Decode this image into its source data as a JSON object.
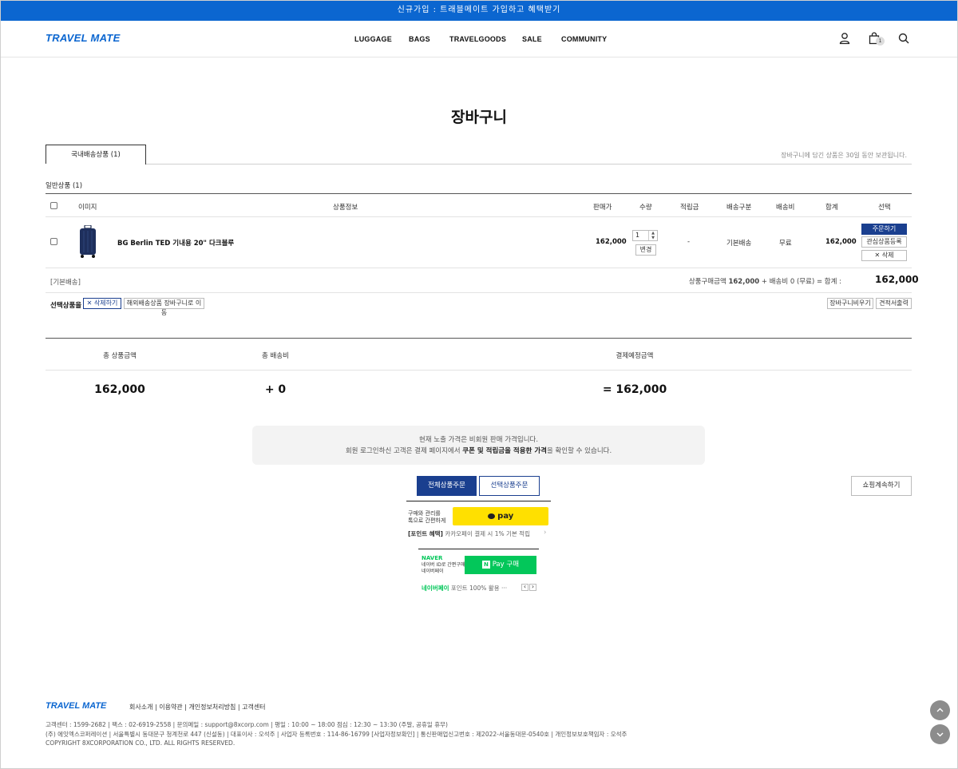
{
  "topbar": {
    "text": "신규가입 : 트래블메이트 가입하고 혜택받기"
  },
  "header": {
    "logo": "TRAVEL MATE",
    "nav": [
      "LUGGAGE",
      "BAGS",
      "TRAVELGOODS",
      "SALE",
      "COMMUNITY"
    ],
    "cart_count": "1",
    "icons": [
      "user-icon",
      "cart-icon",
      "search-icon"
    ]
  },
  "page": {
    "title": "장바구니",
    "tab_label": "국내배송상품 (1)",
    "keep_note": "장바구니에 담긴 상품은 30일 동안 보관됩니다.",
    "section_title": "일반상품 (1)"
  },
  "table": {
    "headers": {
      "image": "이미지",
      "info": "상품정보",
      "price": "판매가",
      "qty": "수량",
      "points": "적립금",
      "ship_type": "배송구분",
      "ship_fee": "배송비",
      "total": "합계",
      "select": "선택"
    },
    "row": {
      "name": "BG Berlin TED 기내용 20\" 다크블루",
      "price": "162,000",
      "qty": "1",
      "change_label": "변경",
      "points": "-",
      "ship_type": "기본배송",
      "ship_fee": "무료",
      "total": "162,000",
      "order_label": "주문하기",
      "wish_label": "관심상품등록",
      "delete_label": "✕ 삭제"
    },
    "group_label": "[기본배송]",
    "summary_prefix": "상품구매금액 ",
    "summary_amount": "162,000",
    "summary_suffix": " + 배송비 0 (무료) = 합계 :",
    "summary_total": "162,000"
  },
  "selected_actions": {
    "label": "선택상품을",
    "delete_label": "✕ 삭제하기",
    "move_label": "해외배송상품 장바구니로 이동",
    "empty_label": "장바구니비우기",
    "estimate_label": "견적서출력"
  },
  "totals": {
    "product_label": "총 상품금액",
    "product_value": "162,000",
    "shipping_label": "총 배송비",
    "shipping_value": "+ 0",
    "pay_label": "결제예정금액",
    "pay_value": "= 162,000"
  },
  "notice": {
    "line1": "현재 노출 가격은 비회원 판매 가격입니다.",
    "line2_prefix": "회원 로그인하신 고객은 결제 페이지에서 ",
    "line2_bold": "쿠폰 및 적립금을 적용한 가격",
    "line2_suffix": "을 확인할 수 있습니다."
  },
  "order_buttons": {
    "all_label": "전체상품주문",
    "selected_label": "선택상품주문",
    "continue_label": "쇼핑계속하기"
  },
  "kakao": {
    "desc_line1": "구매와 관리를",
    "desc_line2": "톡으로 간편하게",
    "pay_label": "pay",
    "benefit_tag": "[포인트 혜택]",
    "benefit_text": " 카카오페이 결제 시 1% 기본 적립"
  },
  "naver": {
    "brand": "NAVER",
    "desc_line1": "네이버 ID로 간편구매",
    "desc_line2": "네이버페이",
    "button_label": "Pay 구매",
    "promo_tag": "네이버페이",
    "promo_text": " 포인트 100% 활용 ···"
  },
  "footer": {
    "logo": "TRAVEL MATE",
    "links": "회사소개  |  이용약관  |  개인정보처리방침  |  고객센터",
    "info1": "고객센터 : 1599-2682  |  팩스 : 02-6919-2558  |  문의메일 : support@8xcorp.com  |  평일 : 10:00 ~ 18:00 점심 : 12:30 ~ 13:30 (주말, 공휴일 휴무)",
    "info2": "(주) 에잇엑스코퍼레이션  |  서울특별시 동대문구 청계천로 447 (신설동)  |  대표이사 : 오석주  |  사업자 등록번호 : 114-86-16799 [사업자정보확인]  |  통신판매업신고번호 : 제2022-서울동대문-0540호  |  개인정보보호책임자 : 오석주",
    "copyright": "COPYRIGHT 8XCORPORATION CO., LTD. ALL RIGHTS RESERVED."
  }
}
